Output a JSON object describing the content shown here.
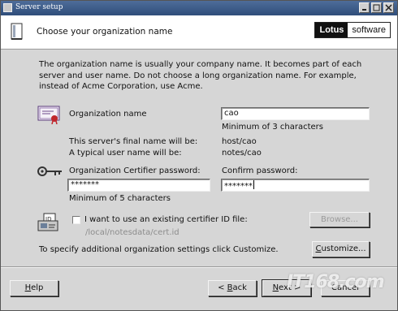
{
  "window": {
    "title": "Server setup"
  },
  "header": {
    "heading": "Choose your organization name",
    "logo_brand": "Lotus",
    "logo_suffix": "software"
  },
  "intro": "The organization name is usually your company name. It becomes part of each server and user name. Do not choose a long organization name. For example, instead of Acme Corporation, use Acme.",
  "organization": {
    "label": "Organization name",
    "value": "cao",
    "hint": "Minimum of 3 characters",
    "server_name_label": "This server's final name will be:",
    "server_name_value": "host/cao",
    "user_name_label": "A typical user name will be:",
    "user_name_value": "notes/cao"
  },
  "certifier": {
    "password_label": "Organization Certifier password:",
    "password_value": "*******",
    "password_hint": "Minimum of 5 characters",
    "confirm_label": "Confirm password:",
    "confirm_value": "*******"
  },
  "id_file": {
    "checkbox_label": "I want to use an existing certifier ID file:",
    "checked": false,
    "path": "/local/notesdata/cert.id",
    "browse_label": "Browse..."
  },
  "customize": {
    "text": "To specify additional organization settings click Customize.",
    "button_label": "Customize..."
  },
  "footer": {
    "help_label": "Help",
    "back_label": "< Back",
    "next_label": "Next >",
    "cancel_label": "Cancel"
  },
  "watermark": "IT168.com",
  "icons": {
    "title_icon": "server-window-icon",
    "header_icon": "document-page-icon",
    "org_icon": "certificate-icon",
    "password_icon": "key-icon",
    "id_file_icon": "id-card-icon"
  }
}
